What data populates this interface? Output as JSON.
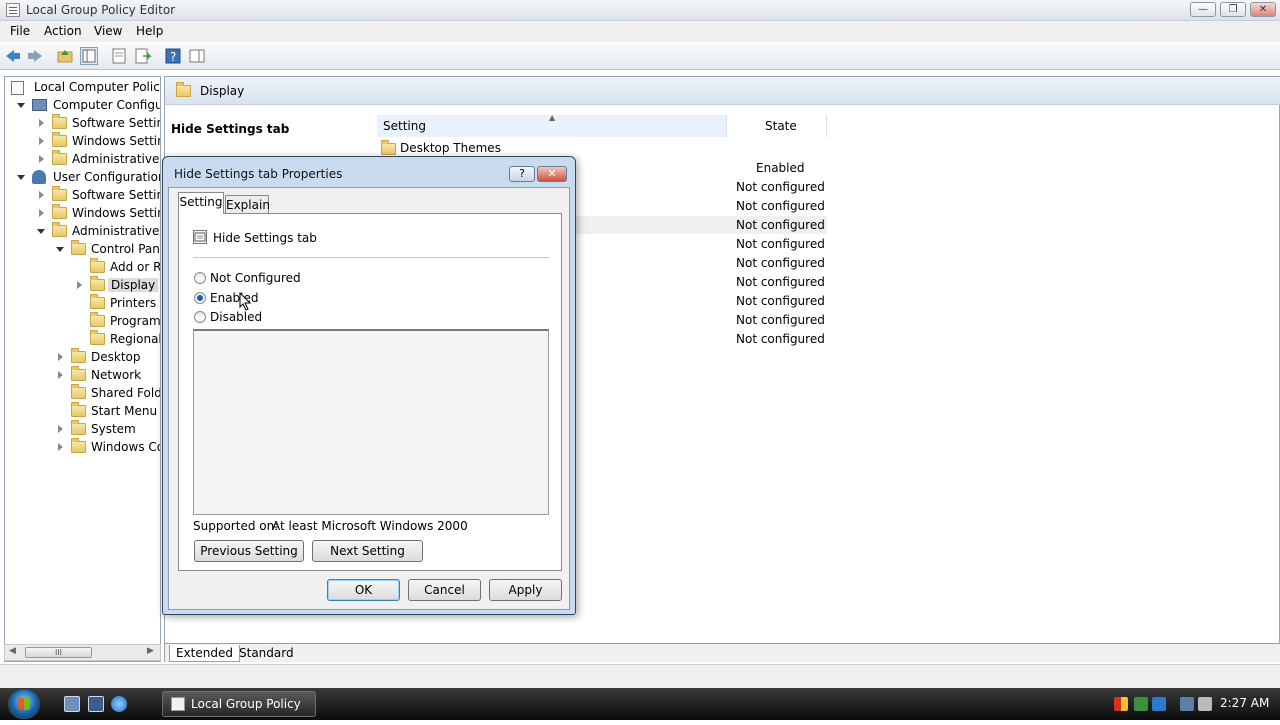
{
  "window": {
    "title": "Local Group Policy Editor",
    "controls": [
      "minimize",
      "restore",
      "close"
    ]
  },
  "menu": [
    "File",
    "Action",
    "View",
    "Help"
  ],
  "toolbar_icons": [
    "back-icon",
    "forward-icon",
    "up-folder-icon",
    "show-hide-tree-icon",
    "properties-icon",
    "export-list-icon",
    "help-icon",
    "show-hide-action-pane-icon"
  ],
  "tree": [
    {
      "label": "Local Computer Policy",
      "icon": "policy-icon"
    },
    {
      "label": "Computer Configura",
      "icon": "computer-icon"
    },
    {
      "label": "Software Settings",
      "icon": "folder-icon"
    },
    {
      "label": "Windows Setting",
      "icon": "folder-icon"
    },
    {
      "label": "Administrative Te",
      "icon": "folder-icon"
    },
    {
      "label": "User Configuration",
      "icon": "user-icon"
    },
    {
      "label": "Software Settings",
      "icon": "folder-icon"
    },
    {
      "label": "Windows Setting",
      "icon": "folder-icon"
    },
    {
      "label": "Administrative Te",
      "icon": "folder-icon"
    },
    {
      "label": "Control Panel",
      "icon": "folder-icon"
    },
    {
      "label": "Add or Re",
      "icon": "folder-icon"
    },
    {
      "label": "Display",
      "icon": "folder-icon"
    },
    {
      "label": "Printers",
      "icon": "folder-icon"
    },
    {
      "label": "Programs",
      "icon": "folder-icon"
    },
    {
      "label": "Regional a",
      "icon": "folder-icon"
    },
    {
      "label": "Desktop",
      "icon": "folder-icon"
    },
    {
      "label": "Network",
      "icon": "folder-icon"
    },
    {
      "label": "Shared Folder",
      "icon": "folder-icon"
    },
    {
      "label": "Start Menu ar",
      "icon": "folder-icon"
    },
    {
      "label": "System",
      "icon": "folder-icon"
    },
    {
      "label": "Windows Cor",
      "icon": "folder-icon"
    }
  ],
  "hscroll_grip": "III",
  "right_pane": {
    "header": "Display",
    "extended_title": "Hide Settings tab",
    "columns": [
      "Setting",
      "State"
    ],
    "folder_row": "Desktop Themes",
    "states": [
      "Enabled",
      "Not configured",
      "Not configured",
      "Not configured",
      "Not configured",
      "Not configured",
      "Not configured",
      "Not configured",
      "Not configured",
      "Not configured"
    ],
    "bottom_tabs": [
      "Extended",
      "Standard"
    ]
  },
  "dialog": {
    "title": "Hide Settings tab Properties",
    "help_button": "?",
    "close_button": "✕",
    "tabs": [
      "Setting",
      "Explain"
    ],
    "setting_name": "Hide Settings tab",
    "options": [
      "Not Configured",
      "Enabled",
      "Disabled"
    ],
    "selected_option": "Enabled",
    "supported_label": "Supported on:",
    "supported_value": "At least Microsoft Windows 2000",
    "previous_button": "Previous Setting",
    "next_button": "Next Setting",
    "ok_button": "OK",
    "cancel_button": "Cancel",
    "apply_button": "Apply"
  },
  "taskbar": {
    "task_label": "Local Group Policy ...",
    "clock": "2:27 AM",
    "quick_launch": [
      "show-desktop-icon",
      "switch-windows-icon",
      "internet-explorer-icon"
    ],
    "tray_icons": [
      "security-shield-icon",
      "network-icon",
      "tray-app-icon",
      "display-icon",
      "volume-icon"
    ]
  },
  "colors": {
    "dialog_frame": "#c9dcef",
    "taskbar": "#1a1a1a",
    "selected_radio": "#1d5fa8"
  }
}
